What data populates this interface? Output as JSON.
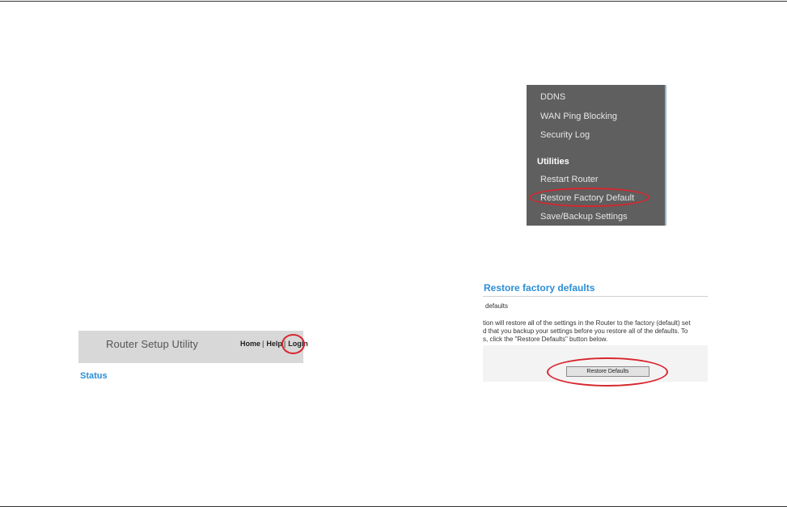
{
  "router_header": {
    "title": "Router Setup Utility",
    "nav": [
      {
        "label": "Home",
        "sep": "|"
      },
      {
        "label": "Help",
        "sep": "|"
      },
      {
        "label": "Login",
        "sep": ""
      }
    ],
    "status_heading": "Status"
  },
  "sidebar_menu": {
    "items_top": [
      "DDNS",
      "WAN Ping Blocking",
      "Security Log"
    ],
    "section_title": "Utilities",
    "items_utilities": [
      "Restart Router",
      "Restore Factory Default",
      "Save/Backup Settings"
    ]
  },
  "restore_page": {
    "title": "Restore factory defaults",
    "subtitle": "defaults",
    "description_lines": [
      "tion will restore all of the settings in the Router to the factory (default) set",
      "d that you backup your settings before you restore all of the defaults. To",
      "s, click the \"Restore Defaults\" button below."
    ],
    "button_label": "Restore Defaults"
  },
  "highlight": {
    "color": "#d8262e"
  }
}
